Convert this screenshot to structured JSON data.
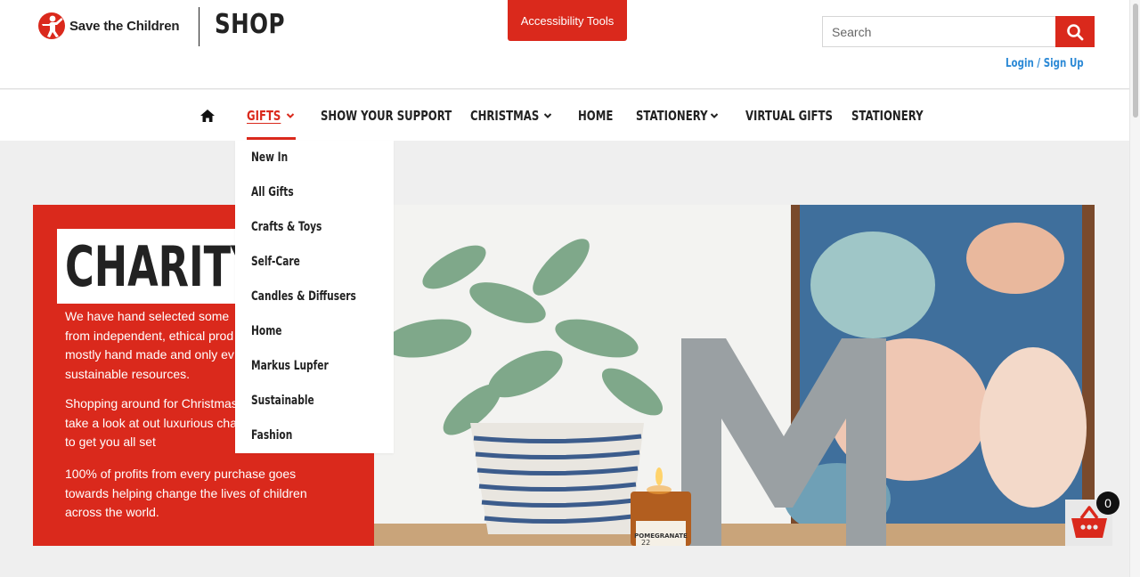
{
  "brand": {
    "org_name": "Save the Children",
    "shop_title": "SHOP"
  },
  "header": {
    "accessibility_label": "Accessibility Tools",
    "search_placeholder": "Search",
    "login_label": "Login / Sign Up"
  },
  "nav": {
    "items": [
      {
        "label": "GIFTS",
        "has_dropdown": true,
        "active": true
      },
      {
        "label": "SHOW YOUR SUPPORT",
        "has_dropdown": false
      },
      {
        "label": "CHRISTMAS",
        "has_dropdown": true
      },
      {
        "label": "HOME",
        "has_dropdown": false
      },
      {
        "label": "STATIONERY",
        "has_dropdown": true
      },
      {
        "label": "VIRTUAL GIFTS",
        "has_dropdown": false
      },
      {
        "label": "STATIONERY",
        "has_dropdown": false
      }
    ]
  },
  "dropdown": {
    "items": [
      "New In",
      "All Gifts",
      "Crafts & Toys",
      "Self-Care",
      "Candles & Diffusers",
      "Home",
      "Markus Lupfer",
      "Sustainable",
      "Fashion"
    ]
  },
  "hero": {
    "title": "CHARITY G",
    "paragraphs": [
      [
        "We have hand selected some",
        "from independent, ethical prod",
        "mostly hand made and only ev",
        "sustainable resources."
      ],
      [
        "Shopping around for Christmas",
        "take a look at out luxurious cha",
        "to get you all set"
      ],
      [
        "100% of profits from every purchase goes",
        "towards helping change the lives of children",
        "across the world."
      ]
    ],
    "candle_label": "POMEGRANATE",
    "candle_number": "22"
  },
  "cart": {
    "count": "0"
  },
  "colors": {
    "brand_red": "#da291c",
    "link_blue": "#2d8ad6",
    "text_dark": "#222222"
  },
  "icons": [
    "save-the-children-logo-icon",
    "search-icon",
    "home-icon",
    "chevron-down-icon",
    "cart-basket-icon"
  ]
}
